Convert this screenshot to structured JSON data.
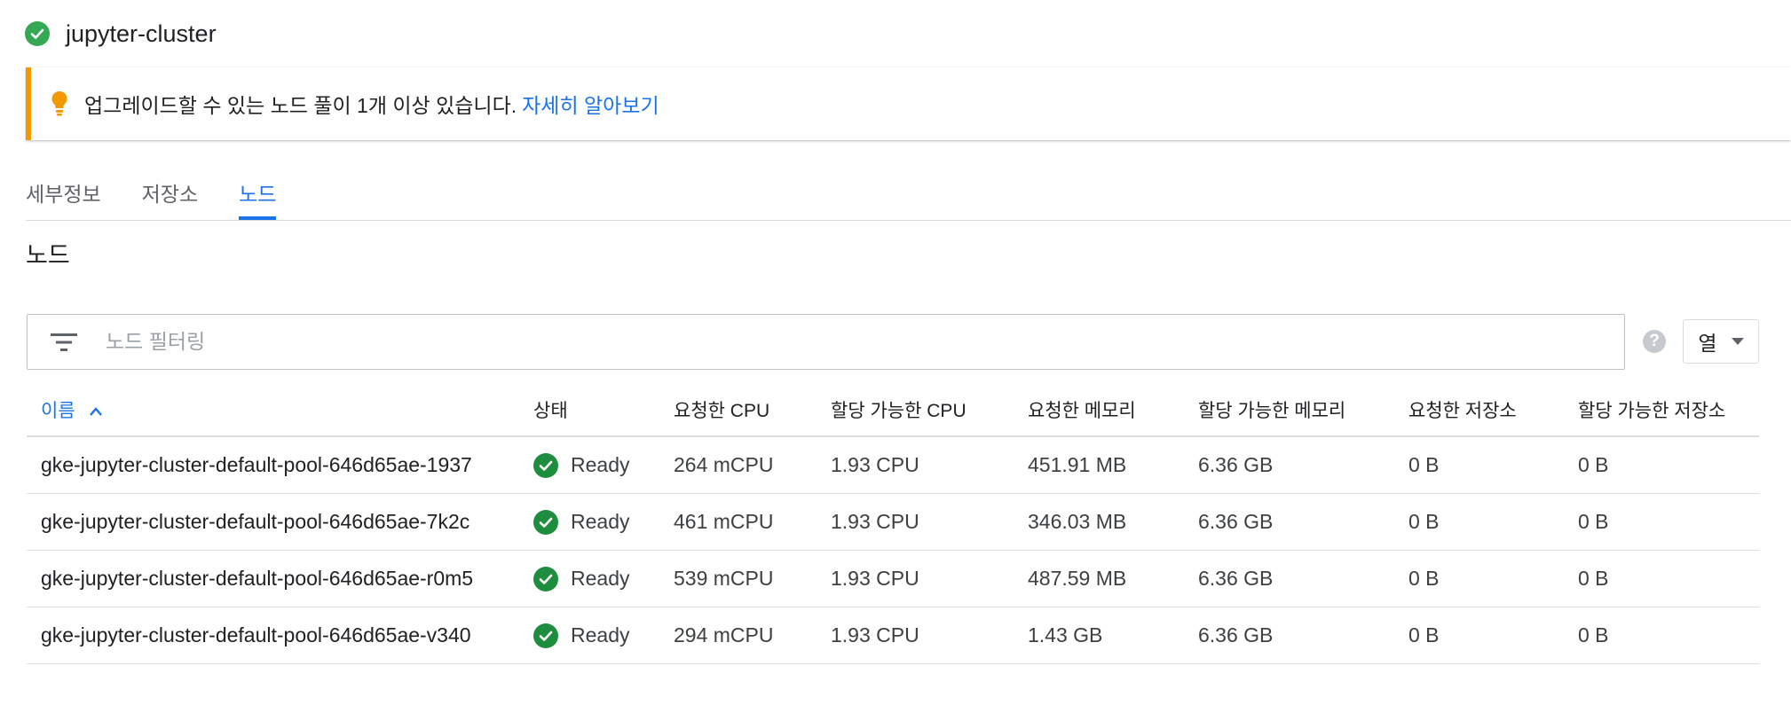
{
  "cluster": {
    "name": "jupyter-cluster",
    "status_icon": "check-circle-icon"
  },
  "banner": {
    "message": "업그레이드할 수 있는 노드 풀이 1개 이상 있습니다.",
    "link": "자세히 알아보기",
    "accent_color": "#f29900"
  },
  "tabs": [
    {
      "label": "세부정보",
      "active": false
    },
    {
      "label": "저장소",
      "active": false
    },
    {
      "label": "노드",
      "active": true
    }
  ],
  "section": {
    "title": "노드"
  },
  "filter": {
    "placeholder": "노드 필터링"
  },
  "columns_button": {
    "label": "열"
  },
  "table": {
    "headers": {
      "name": "이름",
      "status": "상태",
      "req_cpu": "요청한 CPU",
      "alloc_cpu": "할당 가능한 CPU",
      "req_mem": "요청한 메모리",
      "alloc_mem": "할당 가능한 메모리",
      "req_storage": "요청한 저장소",
      "alloc_storage": "할당 가능한 저장소"
    },
    "rows": [
      {
        "name": "gke-jupyter-cluster-default-pool-646d65ae-1937",
        "status": "Ready",
        "req_cpu": "264 mCPU",
        "alloc_cpu": "1.93 CPU",
        "req_mem": "451.91 MB",
        "alloc_mem": "6.36 GB",
        "req_storage": "0 B",
        "alloc_storage": "0 B"
      },
      {
        "name": "gke-jupyter-cluster-default-pool-646d65ae-7k2c",
        "status": "Ready",
        "req_cpu": "461 mCPU",
        "alloc_cpu": "1.93 CPU",
        "req_mem": "346.03 MB",
        "alloc_mem": "6.36 GB",
        "req_storage": "0 B",
        "alloc_storage": "0 B"
      },
      {
        "name": "gke-jupyter-cluster-default-pool-646d65ae-r0m5",
        "status": "Ready",
        "req_cpu": "539 mCPU",
        "alloc_cpu": "1.93 CPU",
        "req_mem": "487.59 MB",
        "alloc_mem": "6.36 GB",
        "req_storage": "0 B",
        "alloc_storage": "0 B"
      },
      {
        "name": "gke-jupyter-cluster-default-pool-646d65ae-v340",
        "status": "Ready",
        "req_cpu": "294 mCPU",
        "alloc_cpu": "1.93 CPU",
        "req_mem": "1.43 GB",
        "alloc_mem": "6.36 GB",
        "req_storage": "0 B",
        "alloc_storage": "0 B"
      }
    ]
  }
}
